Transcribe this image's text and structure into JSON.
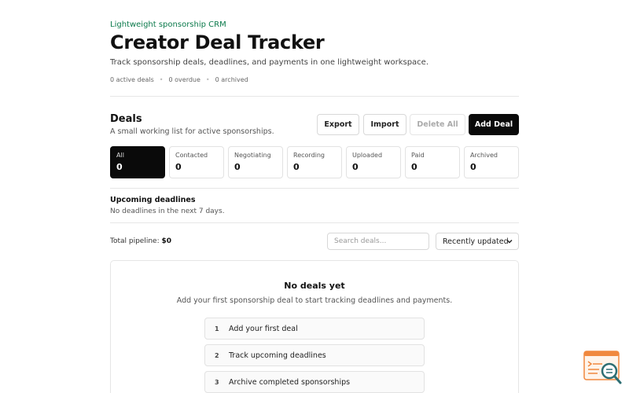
{
  "header": {
    "eyebrow": "Lightweight sponsorship CRM",
    "title": "Creator Deal Tracker",
    "subtitle": "Track sponsorship deals, deadlines, and payments in one lightweight workspace.",
    "stats": [
      "0 active deals",
      "0 overdue",
      "0 archived"
    ]
  },
  "deals": {
    "heading": "Deals",
    "subheading": "A small working list for active sponsorships.",
    "buttons": {
      "export": "Export",
      "import": "Import",
      "delete_all": "Delete All",
      "add_deal": "Add Deal"
    },
    "tabs": [
      {
        "label": "All",
        "count": "0",
        "active": true
      },
      {
        "label": "Contacted",
        "count": "0"
      },
      {
        "label": "Negotiating",
        "count": "0"
      },
      {
        "label": "Recording",
        "count": "0"
      },
      {
        "label": "Uploaded",
        "count": "0"
      },
      {
        "label": "Paid",
        "count": "0"
      },
      {
        "label": "Archived",
        "count": "0"
      }
    ]
  },
  "upcoming": {
    "heading": "Upcoming deadlines",
    "message": "No deadlines in the next 7 days."
  },
  "toolbar": {
    "pipeline_label": "Total pipeline:",
    "pipeline_value": "$0",
    "search_placeholder": "Search deals...",
    "sort_value": "Recently updated"
  },
  "empty_state": {
    "heading": "No deals yet",
    "message": "Add your first sponsorship deal to start tracking deadlines and payments.",
    "steps": [
      {
        "num": "1",
        "text": "Add your first deal"
      },
      {
        "num": "2",
        "text": "Track upcoming deadlines"
      },
      {
        "num": "3",
        "text": "Archive completed sponsorships"
      }
    ]
  },
  "colors": {
    "accent_green": "#0b7a4b",
    "primary_black": "#0a0a0a",
    "logo_orange": "#f0883e",
    "logo_teal": "#2c6e73"
  }
}
